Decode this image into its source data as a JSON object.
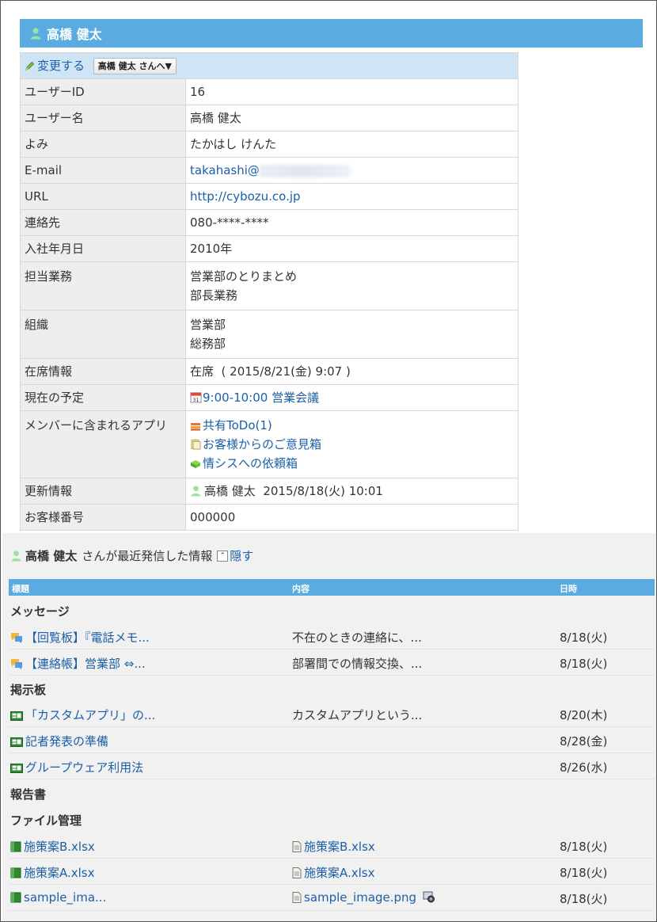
{
  "user": {
    "name": "高橋 健太"
  },
  "toolbar": {
    "edit_label": "変更する",
    "menu_label": "高橋 健太 さんへ▼"
  },
  "fields": [
    {
      "key": "ユーザーID",
      "value": "16"
    },
    {
      "key": "ユーザー名",
      "value": "高橋 健太"
    },
    {
      "key": "よみ",
      "value": "たかはし けんた"
    },
    {
      "key": "E-mail",
      "value": "takahashi@"
    },
    {
      "key": "URL",
      "value": "http://cybozu.co.jp"
    },
    {
      "key": "連絡先",
      "value": "080-****-****"
    },
    {
      "key": "入社年月日",
      "value": "2010年"
    },
    {
      "key": "担当業務",
      "lines": [
        "営業部のとりまとめ",
        "部長業務"
      ]
    },
    {
      "key": "組織",
      "lines": [
        "営業部",
        "総務部"
      ]
    },
    {
      "key": "在席情報",
      "value": "在席  ( 2015/8/21(金) 9:07 )"
    },
    {
      "key": "現在の予定",
      "value": "9:00-10:00 営業会議"
    },
    {
      "key": "メンバーに含まれるアプリ",
      "lines": [
        "共有ToDo(1)",
        "お客様からのご意見箱",
        "情シスへの依頼箱"
      ]
    },
    {
      "key": "更新情報",
      "user": "高橋 健太",
      "value": "2015/8/18(火) 10:01"
    },
    {
      "key": "お客様番号",
      "value": "000000"
    }
  ],
  "recent": {
    "user": "高橋 健太",
    "text": "さんが最近発信した情報",
    "hide_label": "隠す",
    "columns": {
      "title": "標題",
      "content": "内容",
      "date": "日時"
    },
    "categories": [
      {
        "label": "メッセージ",
        "rows": [
          {
            "title": "【回覧板】『電話メモ...",
            "content": "不在のときの連絡に、...",
            "date": "8/18(火)"
          },
          {
            "title": "【連絡帳】営業部 ⇔...",
            "content": "部署間での情報交換、...",
            "date": "8/18(火)"
          }
        ]
      },
      {
        "label": "掲示板",
        "rows": [
          {
            "title": "「カスタムアプリ」の...",
            "content": "カスタムアプリという...",
            "date": "8/20(木)"
          },
          {
            "title": "記者発表の準備",
            "content": "",
            "date": "8/28(金)"
          },
          {
            "title": "グループウェア利用法",
            "content": "",
            "date": "8/26(水)"
          }
        ]
      },
      {
        "label": "報告書",
        "rows": []
      },
      {
        "label": "ファイル管理",
        "rows": [
          {
            "title": "施策案B.xlsx",
            "content": "施策案B.xlsx",
            "date": "8/18(火)"
          },
          {
            "title": "施策案A.xlsx",
            "content": "施策案A.xlsx",
            "date": "8/18(火)"
          },
          {
            "title": "sample_ima...",
            "content": "sample_image.png",
            "date": "8/18(火)"
          }
        ]
      }
    ]
  }
}
